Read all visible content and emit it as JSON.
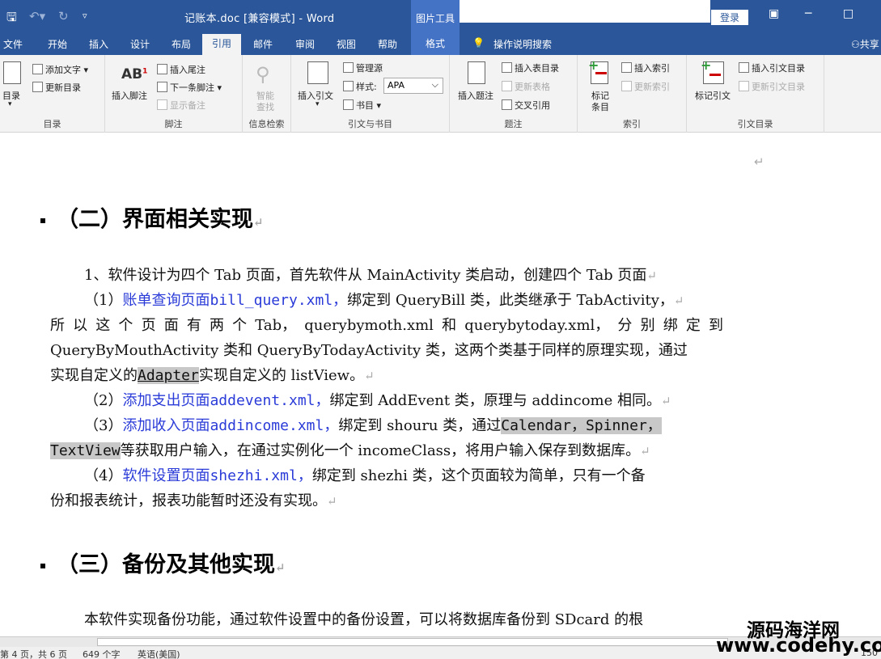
{
  "titlebar": {
    "doc_title": "记账本.doc [兼容模式] - Word",
    "context_tools": "图片工具",
    "login": "登录",
    "minimize": "─",
    "maximize": "□",
    "ribbon_toggle": "▣"
  },
  "tabs": {
    "file": "文件",
    "home": "开始",
    "insert": "插入",
    "design": "设计",
    "layout": "布局",
    "references": "引用",
    "mailings": "邮件",
    "review": "审阅",
    "view": "视图",
    "help": "帮助",
    "format": "格式",
    "tellme": "操作说明搜索",
    "share": "共享"
  },
  "ribbon": {
    "toc": {
      "label": "目录",
      "btn": "目录",
      "add_text": "添加文字",
      "update": "更新目录"
    },
    "footnotes": {
      "label": "脚注",
      "insert_footnote": "插入脚注",
      "insert_endnote": "插入尾注",
      "next_footnote": "下一条脚注",
      "show_notes": "显示备注"
    },
    "research": {
      "label": "信息检索",
      "smart": "智能",
      "lookup": "查找"
    },
    "citations": {
      "label": "引文与书目",
      "insert_citation": "插入引文",
      "manage_sources": "管理源",
      "style_label": "样式:",
      "style_value": "APA",
      "bibliography": "书目"
    },
    "captions": {
      "label": "题注",
      "insert_caption": "插入题注",
      "insert_table_figures": "插入表目录",
      "update_table": "更新表格",
      "cross_ref": "交叉引用"
    },
    "index": {
      "label": "索引",
      "mark_entry1": "标记",
      "mark_entry2": "条目",
      "insert_index": "插入索引",
      "update_index": "更新索引"
    },
    "toa": {
      "label": "引文目录",
      "mark_citation": "标记引文",
      "insert_toa": "插入引文目录",
      "update_toa": "更新引文目录"
    }
  },
  "doc": {
    "pm": "↵",
    "h2a": "（二）界面相关实现",
    "p1": "1、软件设计为四个 Tab 页面，首先软件从 MainActivity 类启动，创建四个 Tab 页面",
    "p2a_prefix": "（1）",
    "p2a_link": "账单查询页面",
    "p2a_file": "bill_query.xml，",
    "p2a_rest": "绑定到 QueryBill 类，此类继承于 TabActivity，",
    "p2b_words": [
      "所",
      "以",
      "这",
      "个",
      "页",
      "面",
      "有",
      "两",
      "个",
      "Tab，",
      "querybymoth.xml",
      "和",
      "querybytoday.xml，",
      "分",
      "别",
      "绑",
      "定",
      "到"
    ],
    "p2c": "QueryByMouthActivity 类和 QueryByTodayActivity 类，这两个类基于同样的原理实现，通过",
    "p2d_prefix": "实现自定义的",
    "p2d_code": "Adapter",
    "p2d_rest": "实现自定义的 listView。",
    "p3_prefix": "（2）",
    "p3_link": "添加支出页面",
    "p3_file": "addevent.xml，",
    "p3_rest": "绑定到 AddEvent 类，原理与 addincome 相同。",
    "p4_prefix": "（3）",
    "p4_link": "添加收入页面",
    "p4_file": "addincome.xml，",
    "p4_rest": "绑定到 shouru 类，通过",
    "p4_code1": "Calendar，Spinner，",
    "p4_code2": "TextView",
    "p4_rest2": "等获取用户输入，在通过实例化一个 incomeClass，将用户输入保存到数据库。",
    "p5_prefix": "（4）",
    "p5_link": "软件设置页面",
    "p5_file": "shezhi.xml，",
    "p5_rest": "绑定到 shezhi 类，这个页面较为简单，只有一个备",
    "p5_line2": "份和报表统计，报表功能暂时还没有实现。",
    "h2b": "（三）备份及其他实现",
    "p6": "本软件实现备份功能，通过软件设置中的备份设置，可以将数据库备份到 SDcard 的根"
  },
  "status": {
    "page": "第 4 页，共 6 页",
    "words": "649 个字",
    "lang": "英语(美国)",
    "zoom": "150"
  },
  "watermark": {
    "line1": "源码海洋网",
    "line2": "www.codehy.com"
  }
}
